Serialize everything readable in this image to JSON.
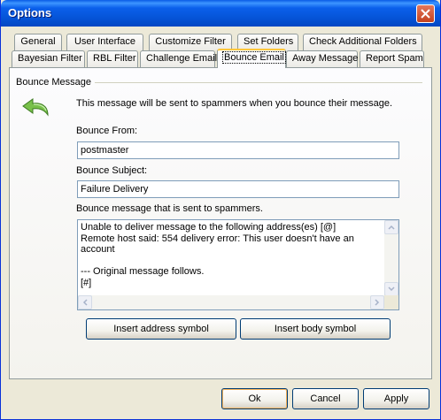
{
  "window": {
    "title": "Options"
  },
  "tabs_row1": [
    {
      "label": "General"
    },
    {
      "label": "User Interface"
    },
    {
      "label": "Customize Filter"
    },
    {
      "label": "Set Folders"
    },
    {
      "label": "Check Additional Folders"
    }
  ],
  "tabs_row2": [
    {
      "label": "Bayesian Filter"
    },
    {
      "label": "RBL Filter"
    },
    {
      "label": "Challenge Email"
    },
    {
      "label": "Bounce Email",
      "active": true
    },
    {
      "label": "Away Message"
    },
    {
      "label": "Report Spam"
    }
  ],
  "group": {
    "label": "Bounce Message",
    "description": "This message will be sent to spammers when you bounce their message."
  },
  "bounce_from": {
    "label": "Bounce From:",
    "value": "postmaster"
  },
  "bounce_subject": {
    "label": "Bounce Subject:",
    "value": "Failure Delivery"
  },
  "bounce_message": {
    "label": "Bounce message that is sent to spammers.",
    "value": "Unable to deliver message to the following address(es) [@]\nRemote host said: 554 delivery error: This user doesn't have an account\n\n--- Original message follows.\n[#]"
  },
  "buttons": {
    "insert_address": "Insert address symbol",
    "insert_body": "Insert body symbol",
    "ok": "Ok",
    "cancel": "Cancel",
    "apply": "Apply"
  },
  "icons": {
    "back_arrow": "green-curved-arrow-icon",
    "close": "close-icon"
  },
  "colors": {
    "titlebar": "#0553d6",
    "window_bg": "#ece9d8",
    "active_tab_highlight": "#ffc73c",
    "arrow_green": "#6bb43c"
  }
}
